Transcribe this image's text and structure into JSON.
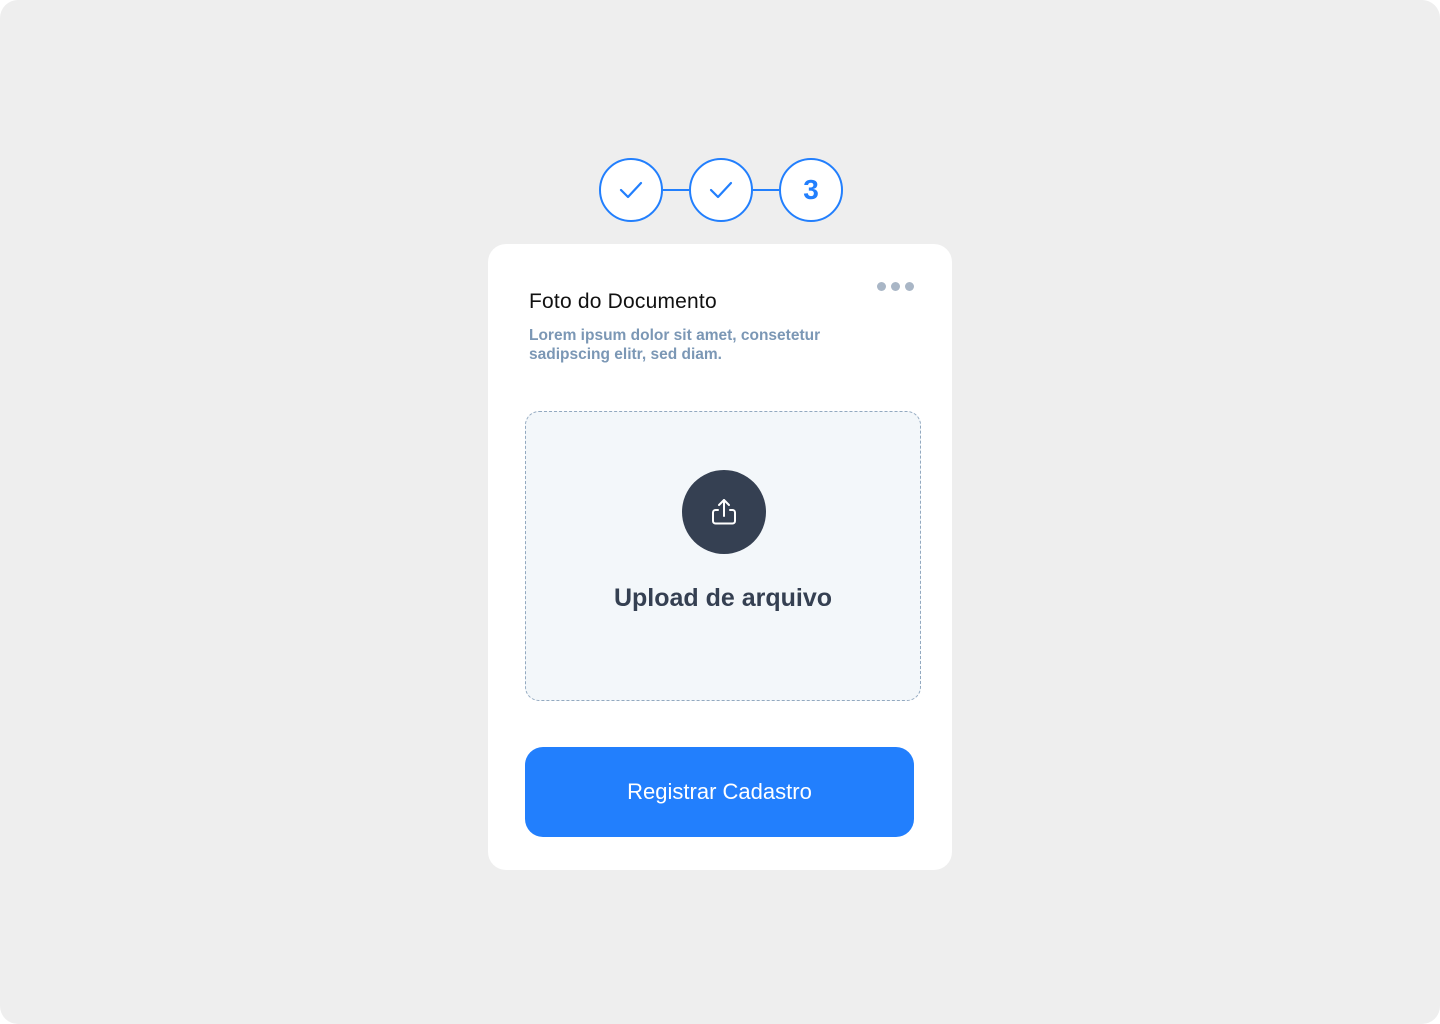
{
  "stepper": {
    "steps": [
      {
        "status": "completed",
        "icon": "check-icon"
      },
      {
        "status": "completed",
        "icon": "check-icon"
      },
      {
        "status": "current",
        "label": "3"
      }
    ]
  },
  "card": {
    "menu_icon": "more-dots-icon",
    "title": "Foto do Documento",
    "subtitle": "Lorem ipsum dolor sit amet, consetetur sadipscing elitr, sed diam.",
    "upload": {
      "icon": "upload-share-icon",
      "label": "Upload de arquivo"
    },
    "submit_label": "Registrar Cadastro"
  },
  "colors": {
    "accent": "#227ffd",
    "dark": "#354052",
    "muted": "#7b97b5",
    "background": "#eeeeee",
    "card": "#ffffff",
    "dropzone": "#f3f7fa"
  }
}
